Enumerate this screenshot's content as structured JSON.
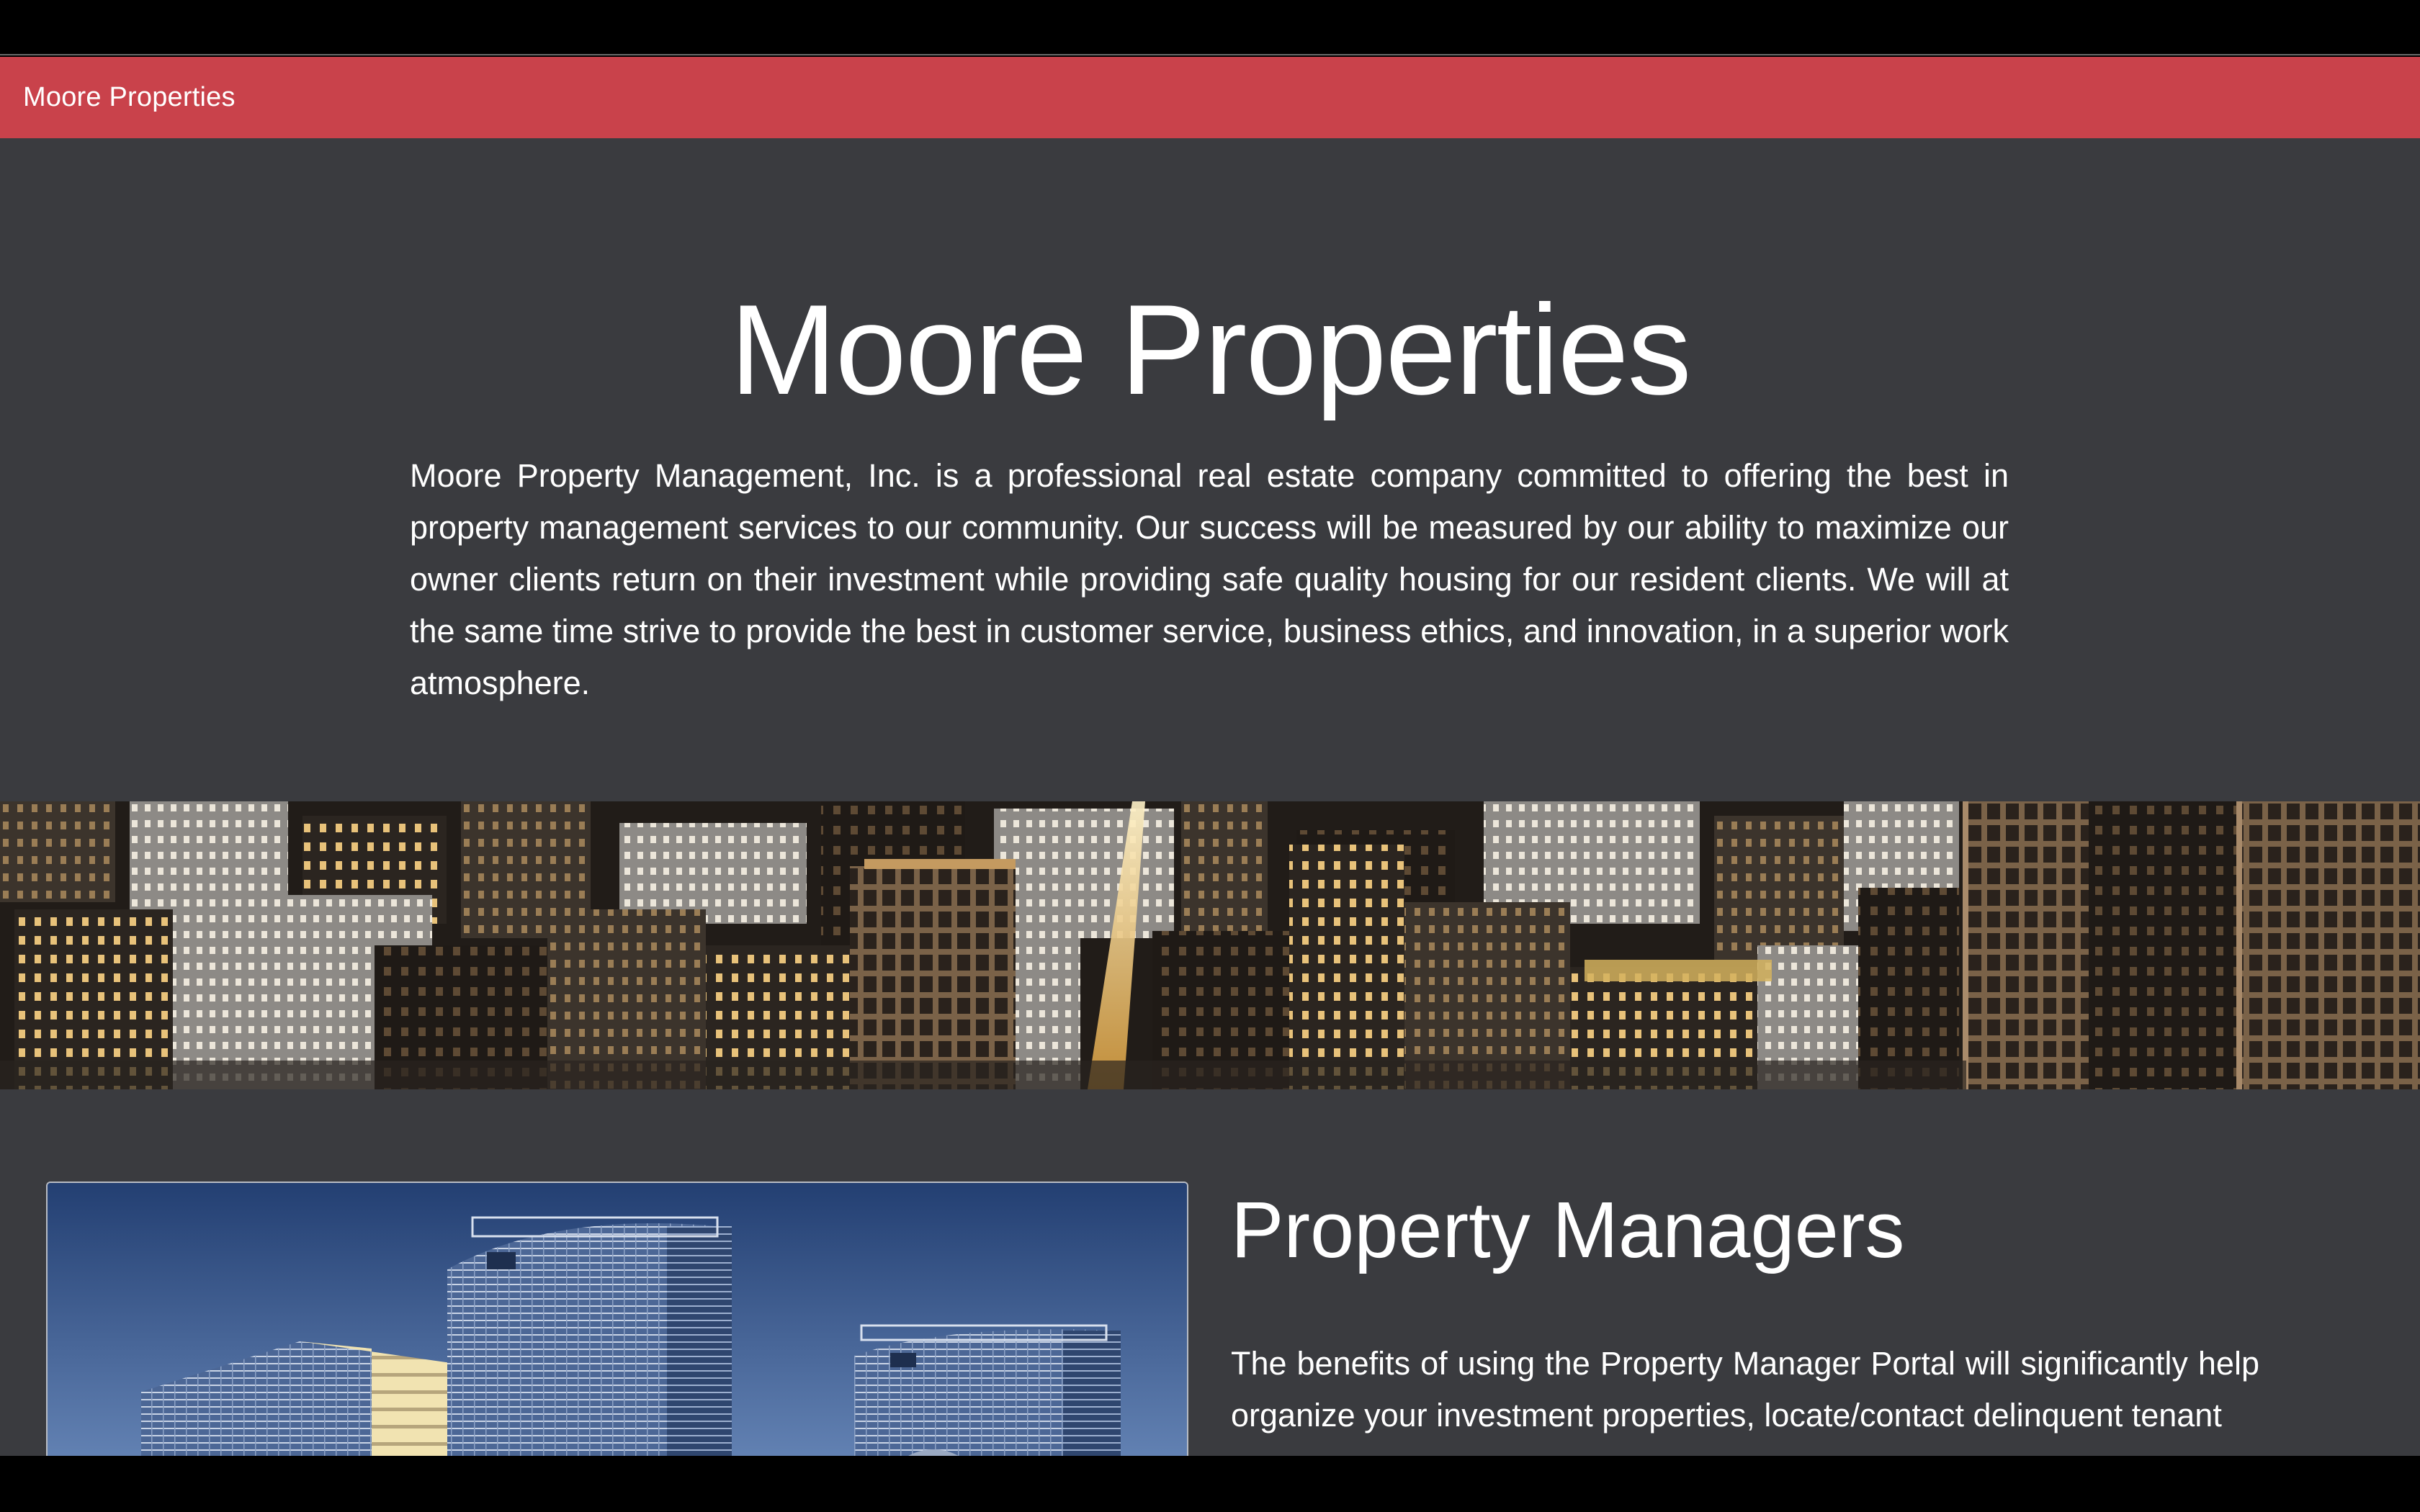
{
  "navbar": {
    "brand": "Moore Properties"
  },
  "hero": {
    "title": "Moore Properties",
    "text": "Moore Property Management, Inc. is a professional real estate company committed to offering the best in property management services to our community. Our success will be measured by our ability to maximize our owner clients return on their investment while providing safe quality housing for our resident clients. We will at the same time strive to provide the best in customer service, business ethics, and innovation, in a superior work atmosphere."
  },
  "property_managers": {
    "title": "Property Managers",
    "text": "The benefits of using the Property Manager Portal will significantly help organize your investment properties, locate/contact delinquent tenant"
  },
  "colors": {
    "navbar": "#c9424b",
    "page_background": "#3a3b3f",
    "text": "#ffffff"
  }
}
